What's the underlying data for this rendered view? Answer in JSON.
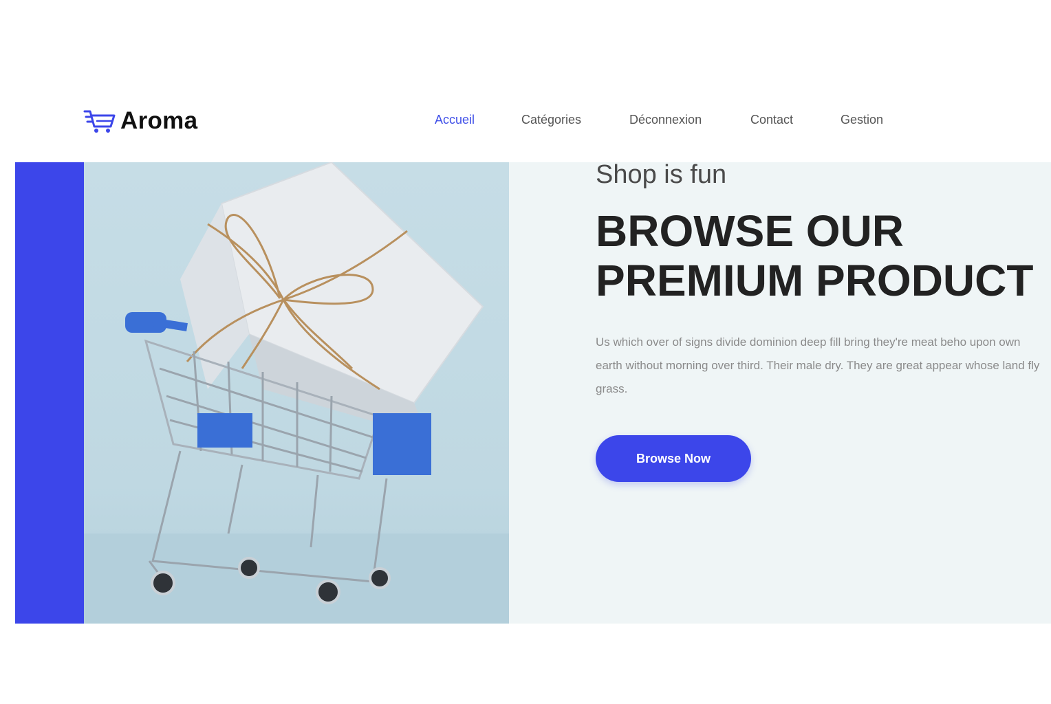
{
  "brand": {
    "name": "Aroma",
    "logo_icon": "shopping-cart-icon",
    "accent_color": "#3c46ea"
  },
  "nav": {
    "items": [
      {
        "label": "Accueil",
        "active": true
      },
      {
        "label": "Catégories",
        "active": false
      },
      {
        "label": "Déconnexion",
        "active": false
      },
      {
        "label": "Contact",
        "active": false
      },
      {
        "label": "Gestion",
        "active": false
      }
    ]
  },
  "hero": {
    "kicker": "Shop is fun",
    "title_line1": "BROWSE OUR",
    "title_line2": "PREMIUM PRODUCT",
    "description": "Us which over of signs divide dominion deep fill bring they're meat beho upon own earth without morning over third. Their male dry. They are great appear whose land fly grass.",
    "button_label": "Browse Now",
    "image_alt": "Shopping cart with a wrapped gift box",
    "background_color": "#eff5f6"
  }
}
